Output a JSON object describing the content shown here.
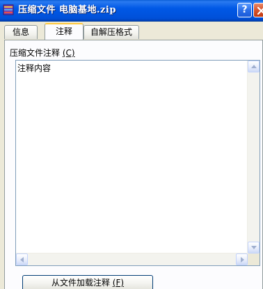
{
  "window": {
    "title": "压缩文件 电脑基地.zip",
    "help_label": "?"
  },
  "tabs": [
    {
      "label": "信息"
    },
    {
      "label": "注释",
      "active": true
    },
    {
      "label": "自解压格式"
    }
  ],
  "comment": {
    "label": "压缩文件注释",
    "shortcut": "(C)",
    "value": "注释内容"
  },
  "actions": {
    "load_label": "从文件加载注释",
    "load_shortcut": "(F)"
  },
  "icons": {
    "title": "archive-icon",
    "close": "close-icon",
    "scroll_up": "arrow-up-icon",
    "scroll_down": "arrow-down-icon",
    "scroll_left": "arrow-left-icon",
    "scroll_right": "arrow-right-icon"
  },
  "colors": {
    "title_bar": "#0058e6",
    "active_tab_accent": "#ffc83c",
    "close_button": "#d8542c"
  }
}
